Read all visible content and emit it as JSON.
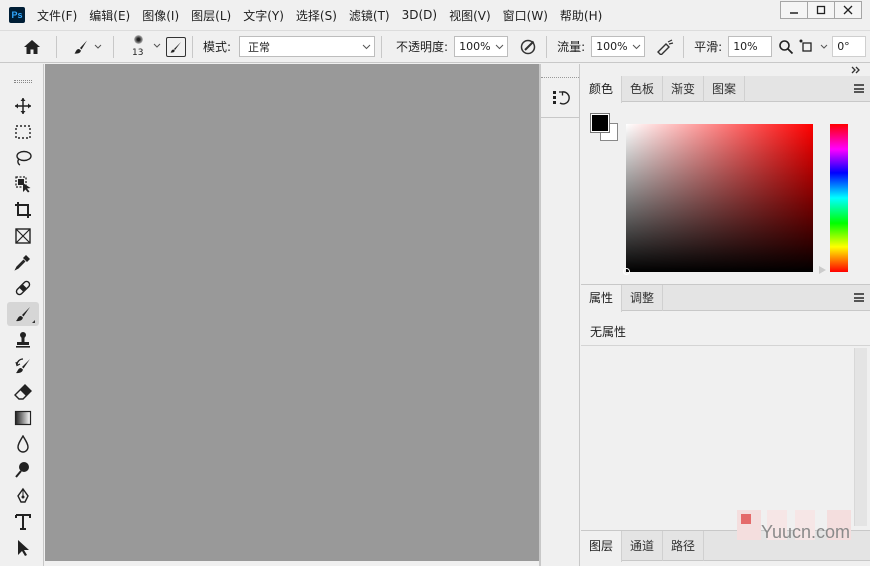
{
  "app": {
    "logo": "Ps"
  },
  "menu": {
    "items": [
      "文件(F)",
      "编辑(E)",
      "图像(I)",
      "图层(L)",
      "文字(Y)",
      "选择(S)",
      "滤镜(T)",
      "3D(D)",
      "视图(V)",
      "窗口(W)",
      "帮助(H)"
    ]
  },
  "options": {
    "brush_size": "13",
    "mode_label": "模式:",
    "mode_value": "正常",
    "opacity_label": "不透明度:",
    "opacity_value": "100%",
    "flow_label": "流量:",
    "flow_value": "100%",
    "smoothing_label": "平滑:",
    "smoothing_value": "10%",
    "angle_value": "0°"
  },
  "color_panel": {
    "tabs": [
      "颜色",
      "色板",
      "渐变",
      "图案"
    ],
    "active_tab": "颜色",
    "foreground": "#000000",
    "background": "#ffffff",
    "hue_color": "#ff0000"
  },
  "properties_panel": {
    "tabs": [
      "属性",
      "调整"
    ],
    "active_tab": "属性",
    "empty_text": "无属性"
  },
  "layers_panel": {
    "tabs": [
      "图层",
      "通道",
      "路径"
    ],
    "active_tab": "图层"
  },
  "canvas": {
    "background": "#999999"
  },
  "watermark": {
    "text": "Yuucn.com"
  }
}
